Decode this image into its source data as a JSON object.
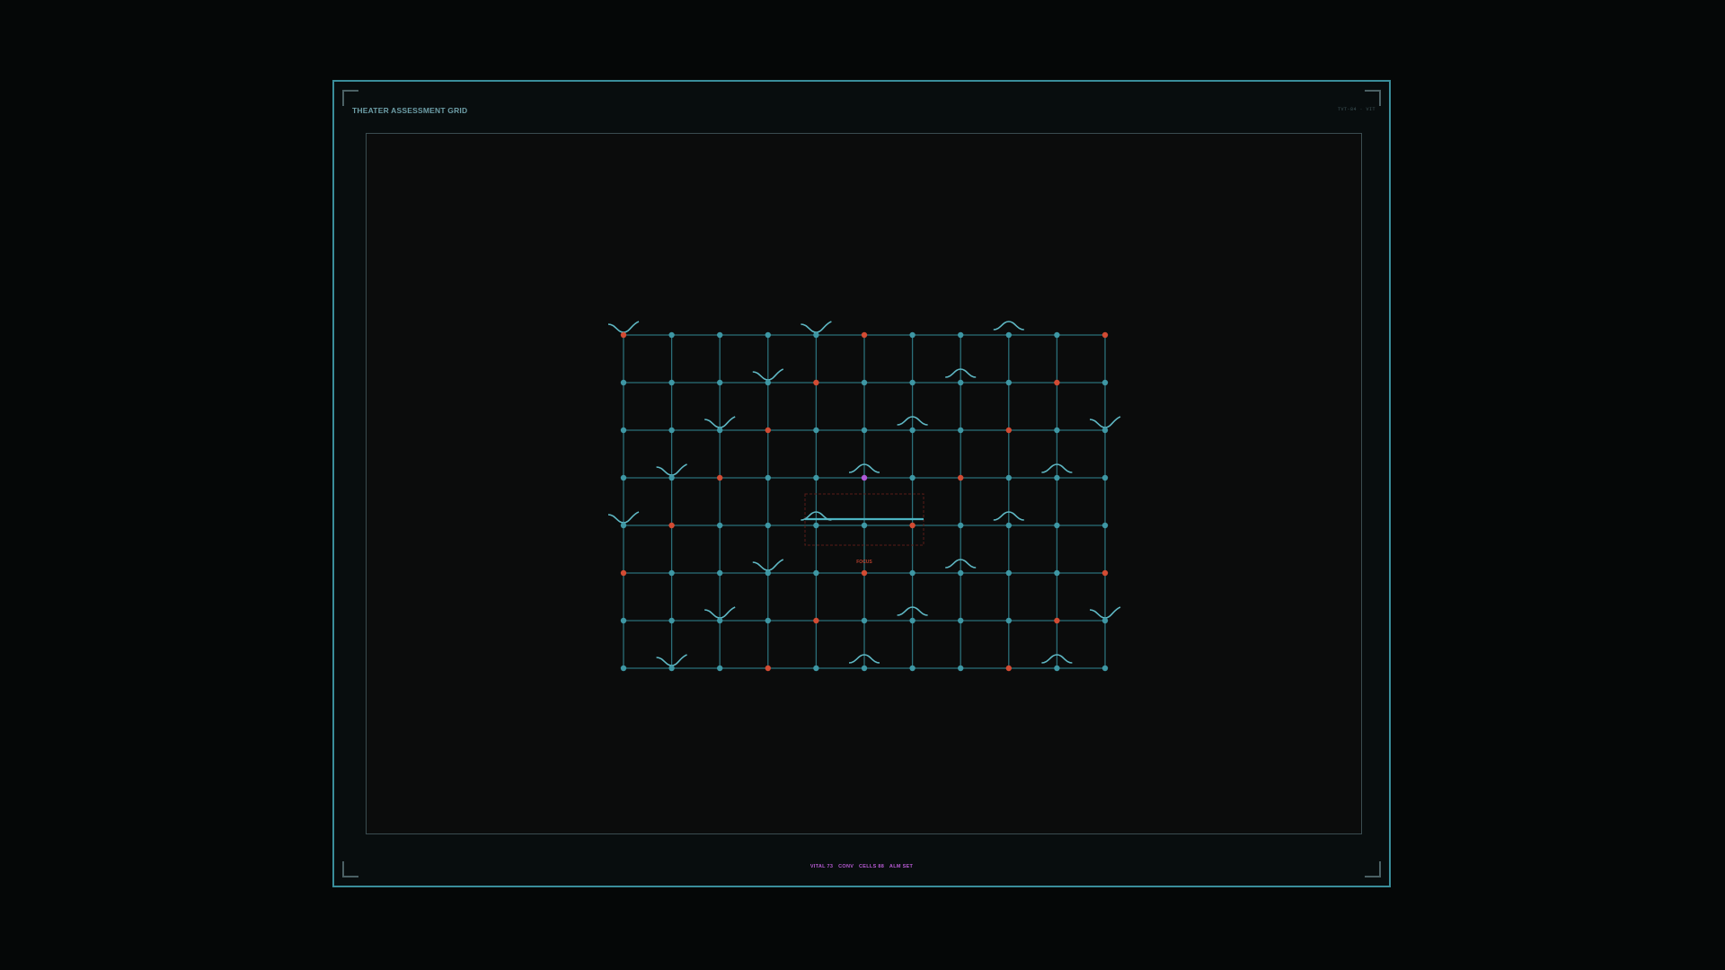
{
  "app": {
    "title": "THEATER ASSESSMENT GRID",
    "tag": "TVT-84 · VIT"
  },
  "grid": {
    "cols": 11,
    "rows": 8,
    "line_color": "#2b6f79",
    "node_color": "#3e97a4",
    "alert_color": "#d24b33",
    "focus_color": "#b05ad8",
    "alert_nodes": [
      [
        0,
        0
      ],
      [
        5,
        0
      ],
      [
        10,
        0
      ],
      [
        4,
        1
      ],
      [
        9,
        1
      ],
      [
        3,
        2
      ],
      [
        8,
        2
      ],
      [
        2,
        3
      ],
      [
        7,
        3
      ],
      [
        1,
        4
      ],
      [
        6,
        4
      ],
      [
        0,
        5
      ],
      [
        5,
        5
      ],
      [
        10,
        5
      ],
      [
        4,
        6
      ],
      [
        9,
        6
      ],
      [
        3,
        7
      ],
      [
        8,
        7
      ]
    ],
    "focus_node": [
      5,
      3
    ],
    "wave_markers": [
      {
        "col": 0,
        "row": 0,
        "shape": "trough"
      },
      {
        "col": 4,
        "row": 0,
        "shape": "trough"
      },
      {
        "col": 8,
        "row": 0,
        "shape": "crest"
      },
      {
        "col": 3,
        "row": 1,
        "shape": "trough"
      },
      {
        "col": 7,
        "row": 1,
        "shape": "crest"
      },
      {
        "col": 2,
        "row": 2,
        "shape": "trough"
      },
      {
        "col": 6,
        "row": 2,
        "shape": "crest"
      },
      {
        "col": 10,
        "row": 2,
        "shape": "trough"
      },
      {
        "col": 1,
        "row": 3,
        "shape": "trough"
      },
      {
        "col": 5,
        "row": 3,
        "shape": "crest"
      },
      {
        "col": 9,
        "row": 3,
        "shape": "crest"
      },
      {
        "col": 0,
        "row": 4,
        "shape": "trough"
      },
      {
        "col": 4,
        "row": 4,
        "shape": "crest"
      },
      {
        "col": 8,
        "row": 4,
        "shape": "crest"
      },
      {
        "col": 3,
        "row": 5,
        "shape": "trough"
      },
      {
        "col": 7,
        "row": 5,
        "shape": "crest"
      },
      {
        "col": 2,
        "row": 6,
        "shape": "trough"
      },
      {
        "col": 6,
        "row": 6,
        "shape": "crest"
      },
      {
        "col": 10,
        "row": 6,
        "shape": "trough"
      },
      {
        "col": 1,
        "row": 7,
        "shape": "trough"
      },
      {
        "col": 5,
        "row": 7,
        "shape": "crest"
      },
      {
        "col": 9,
        "row": 7,
        "shape": "crest"
      }
    ],
    "focus_label": "FOCUS"
  },
  "status": {
    "vital": "VITAL 73",
    "conv": "CONV",
    "cells": "CELLS 88",
    "alm": "ALM SET"
  }
}
